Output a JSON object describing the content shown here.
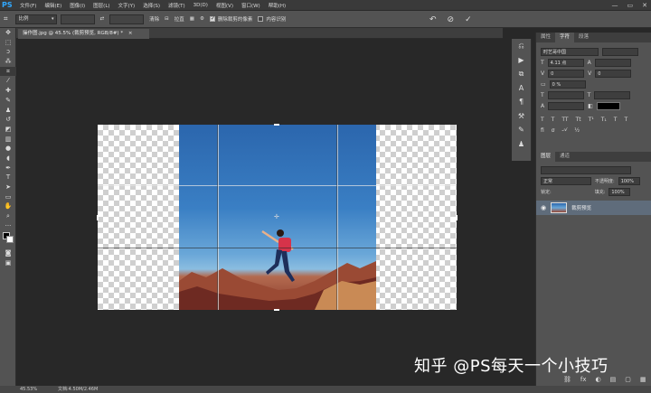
{
  "app": {
    "logo": "PS"
  },
  "menu": [
    "文件(F)",
    "编辑(E)",
    "图像(I)",
    "图层(L)",
    "文字(Y)",
    "选择(S)",
    "滤镜(T)",
    "3D(D)",
    "视图(V)",
    "窗口(W)",
    "帮助(H)"
  ],
  "window_controls": [
    "—",
    "▭",
    "✕"
  ],
  "options": {
    "tool_icon": "crop-icon",
    "ratio_label": "比例",
    "swap_icon": "⇄",
    "clear_label": "清除",
    "straighten_label": "拉直",
    "delete_cropped_label": "删除裁剪的像素",
    "delete_cropped_checked": true,
    "content_aware_label": "内容识别",
    "content_aware_checked": false,
    "reset_icon": "↶",
    "cancel_icon": "⊘",
    "commit_icon": "✓"
  },
  "document": {
    "tab_title": "操作图.jpg @ 45.5% (裁剪预览, RGB/8#) *",
    "close": "×"
  },
  "status": {
    "zoom": "45.53%",
    "doc": "文档:4.50M/2.46M"
  },
  "watermark": "知乎 @PS每天一个小技巧",
  "panel": {
    "tabs": [
      "属性",
      "字符",
      "段落"
    ],
    "active_tab": "字符",
    "font_family": "时艺哥中国",
    "font_size": "4.11 点",
    "tracking_value": "0",
    "scale_value": "0 %",
    "color": "#000000"
  },
  "layers": {
    "tabs": [
      "图层",
      "通道"
    ],
    "blend_mode": "正常",
    "opacity_label": "不透明度:",
    "opacity": "100%",
    "fill_label": "填充:",
    "fill": "100%",
    "lock_label": "锁定:",
    "layer_name": "裁剪预览",
    "footer_icons": [
      "⛓",
      "fx",
      "◐",
      "▤",
      "▢",
      "▦",
      "🗑"
    ]
  }
}
